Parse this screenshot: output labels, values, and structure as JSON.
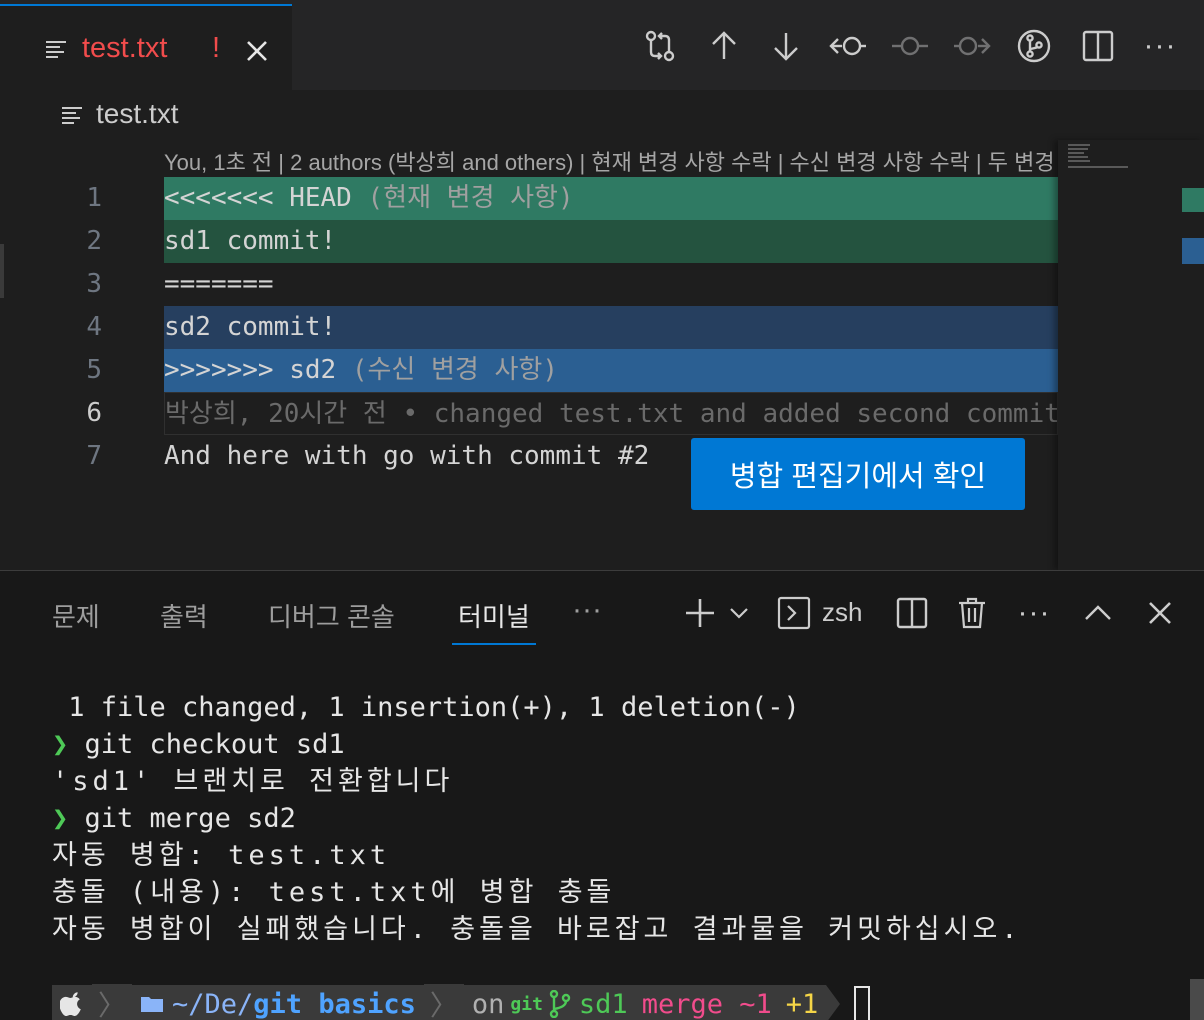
{
  "tab": {
    "filename": "test.txt",
    "status": "!",
    "close": "×"
  },
  "editor_actions": [
    {
      "name": "compare-changes-icon"
    },
    {
      "name": "previous-change-icon"
    },
    {
      "name": "next-change-icon"
    },
    {
      "name": "open-previous-revision-icon"
    },
    {
      "name": "open-revision-icon"
    },
    {
      "name": "open-next-revision-icon"
    },
    {
      "name": "git-graph-icon"
    },
    {
      "name": "split-editor-icon"
    },
    {
      "name": "more-actions-icon"
    }
  ],
  "breadcrumb": {
    "filename": "test.txt"
  },
  "codelens": "You, 1초 전 | 2 authors (박상희 and others) | 현재 변경 사항 수락 | 수신 변경 사항 수락 | 두 변경 사항 모두 수락 | 변경 사항 비교",
  "lines": {
    "n1": "1",
    "n2": "2",
    "n3": "3",
    "n4": "4",
    "n5": "5",
    "n6": "6",
    "n7": "7",
    "l1": "<<<<<<< HEAD",
    "l1_hint": " (현재 변경 사항)",
    "l2": "sd1 commit!",
    "l3": "=======",
    "l4": "sd2 commit!",
    "l5": ">>>>>>> sd2",
    "l5_hint": " (수신 변경 사항)",
    "l6_blame": "      박상희, 20시간 전 • changed test.txt and added second commit",
    "l7": "And here with go with commit #2"
  },
  "merge_button": "병합 편집기에서 확인",
  "panel": {
    "tabs": {
      "problems": "문제",
      "output": "출력",
      "debug": "디버그 콘솔",
      "terminal": "터미널",
      "more": "···"
    },
    "shell": "zsh"
  },
  "terminal": {
    "t1": " 1 file changed, 1 insertion(+), 1 deletion(-)",
    "t2_arrow": "❯",
    "t2": " git checkout sd1",
    "t3": "'sd1' 브랜치로 전환합니다",
    "t4_arrow": "❯",
    "t4": " git merge sd2",
    "t5": "자동 병합: test.txt",
    "t6": "충돌 (내용): test.txt에 병합 충돌",
    "t7": "자동 병합이 실패했습니다. 충돌을 바로잡고 결과물을 커밋하십시오."
  },
  "prompt": {
    "path_prefix": "~/De/",
    "path_current": "git basics",
    "on": "on",
    "git": "git",
    "branch": "sd1",
    "merge": "merge ~1",
    "plus": "+1"
  },
  "colors": {
    "accent": "#0078d4",
    "conflict_error": "#f14c4c",
    "current_change": "#2f7a63",
    "incoming_change": "#2b5f92"
  }
}
